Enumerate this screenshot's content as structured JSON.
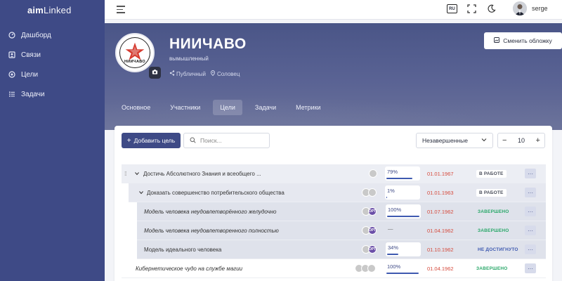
{
  "app": {
    "logo_part1": "aim",
    "logo_part2": "Linked"
  },
  "sidebar": {
    "items": [
      {
        "label": "Дашборд",
        "icon": "dashboard-icon"
      },
      {
        "label": "Связи",
        "icon": "contacts-icon"
      },
      {
        "label": "Цели",
        "icon": "target-icon"
      },
      {
        "label": "Задачи",
        "icon": "tasks-icon"
      }
    ]
  },
  "topbar": {
    "lang": "RU",
    "username": "serge"
  },
  "org": {
    "title": "НИИЧАВО",
    "subtitle": "вымышленный",
    "visibility": "Публичный",
    "location": "Соловец",
    "emblem_text": "НИИЧАВО",
    "cover_button": "Сменить обложку"
  },
  "tabs": [
    {
      "label": "Основное",
      "active": false
    },
    {
      "label": "Участники",
      "active": false
    },
    {
      "label": "Цели",
      "active": true
    },
    {
      "label": "Задачи",
      "active": false
    },
    {
      "label": "Метрики",
      "active": false
    }
  ],
  "toolbar": {
    "add_label": "Добавить цель",
    "search_placeholder": "Поиск...",
    "filter_value": "Незавершенные",
    "page_size": "10",
    "minus": "−",
    "plus": "+"
  },
  "goals": [
    {
      "name": "Достичь Абсолютного Знания и всеобщего ...",
      "level": 0,
      "progress": "79%",
      "fill": 0.79,
      "date": "01.01.1967",
      "status": "В РАБОТЕ",
      "status_kind": "work",
      "avatars": [
        "avatar"
      ],
      "more": "···"
    },
    {
      "name": "Доказать совершенство потребительского общества",
      "level": 1,
      "progress": "1%",
      "fill": 0.01,
      "date": "01.01.1963",
      "status": "В РАБОТЕ",
      "status_kind": "work",
      "avatars": [
        "avatar",
        "avatar"
      ],
      "more": "···"
    },
    {
      "name": "Модель человека неудовлетворённого желудочно",
      "level": 2,
      "progress": "100%",
      "fill": 1.0,
      "date": "01.07.1962",
      "status": "ЗАВЕРШЕНО",
      "status_kind": "done",
      "avatars": [
        "avatar",
        "ОРТ"
      ],
      "italic": true,
      "more": "···"
    },
    {
      "name": "Модель человека неудовлетворенного полностью",
      "level": 2,
      "progress": "—",
      "fill": 0,
      "date": "01.04.1962",
      "status": "ЗАВЕРШЕНО",
      "status_kind": "done",
      "avatars": [
        "avatar",
        "ОРТ"
      ],
      "italic": true,
      "more": "···"
    },
    {
      "name": "Модель идеального человека",
      "level": 2,
      "progress": "34%",
      "fill": 0.34,
      "date": "01.10.1962",
      "status": "НЕ ДОСТИГНУТО",
      "status_kind": "fail",
      "avatars": [
        "avatar",
        "ОРТ"
      ],
      "more": "···"
    },
    {
      "name": "Кибернетическое чудо на службе магии",
      "level": 0,
      "progress": "100%",
      "fill": 1.0,
      "date": "01.04.1962",
      "status": "ЗАВЕРШЕНО",
      "status_kind": "done",
      "avatars": [
        "avatar",
        "avatar",
        "avatar"
      ],
      "italic": true,
      "more": "···"
    }
  ]
}
